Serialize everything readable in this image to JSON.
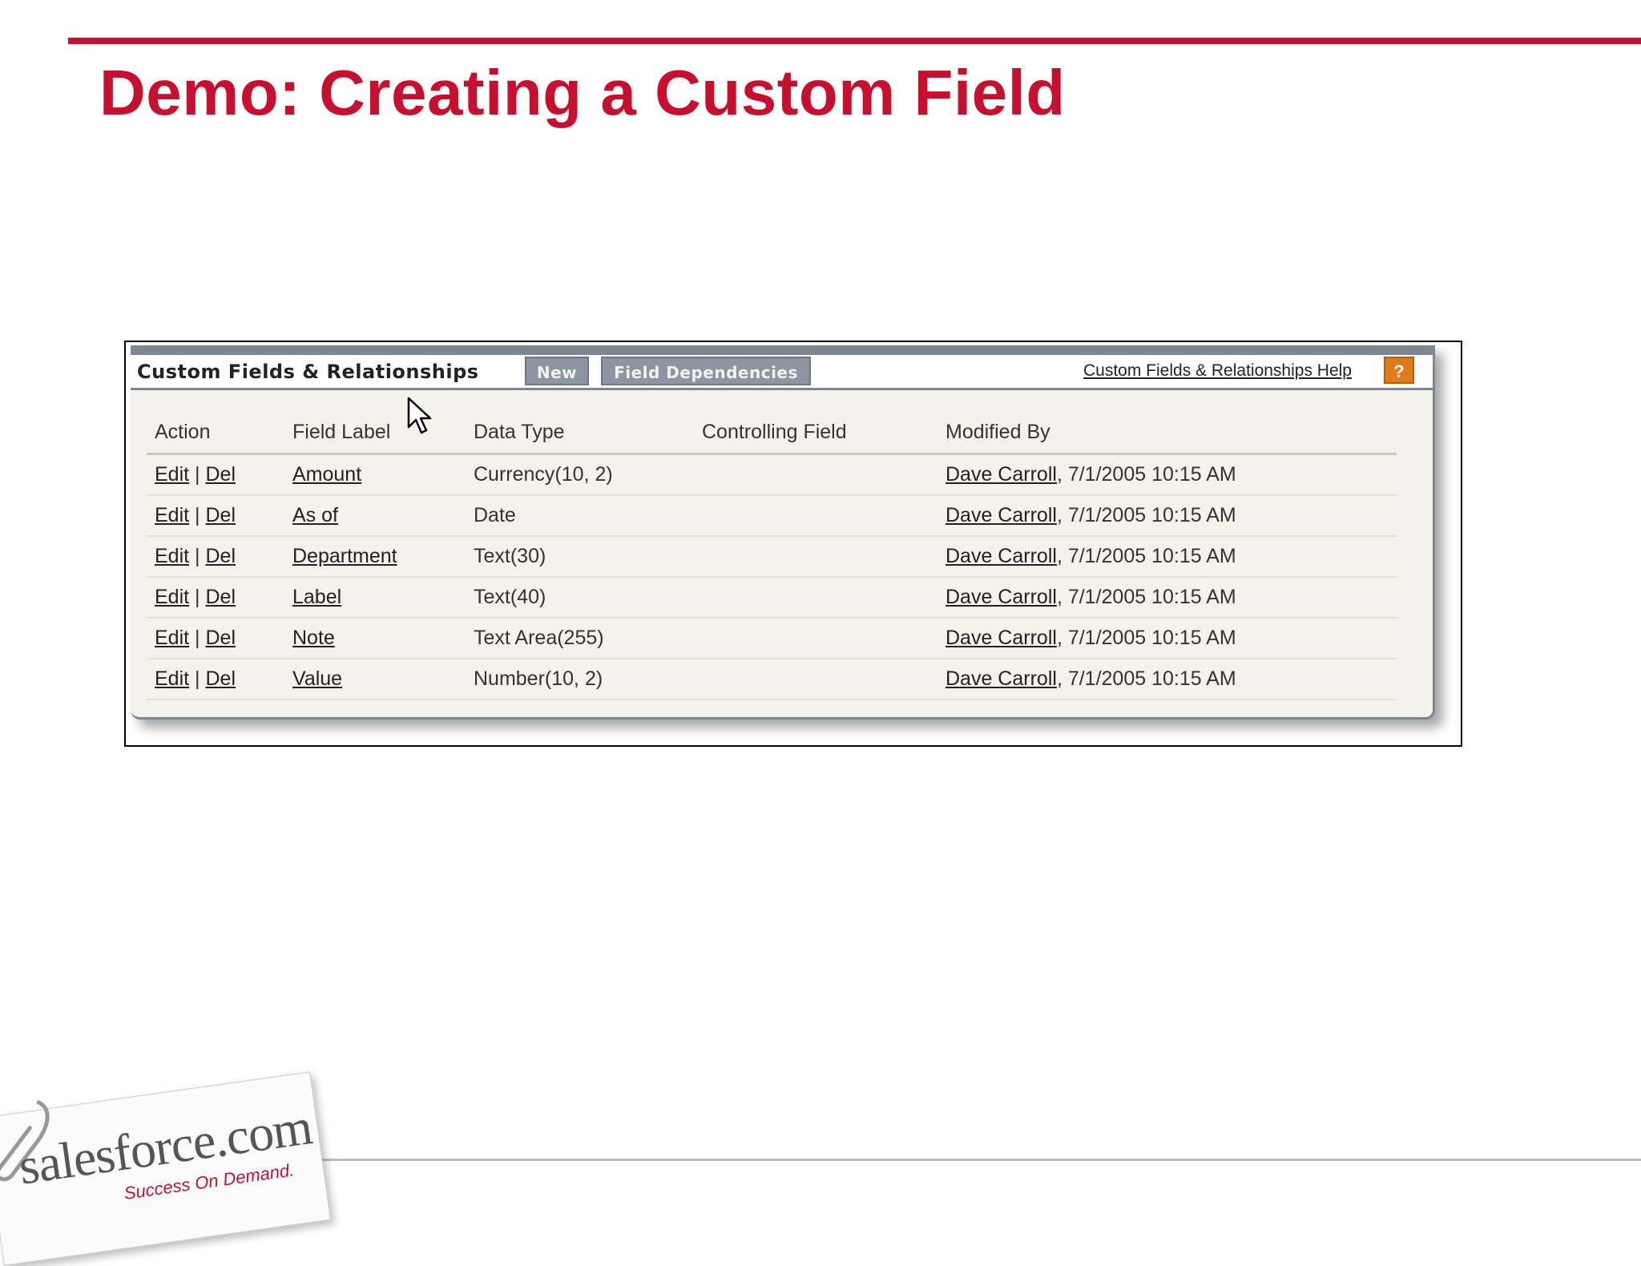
{
  "slide": {
    "title": "Demo: Creating a Custom Field"
  },
  "panel": {
    "title": "Custom Fields & Relationships",
    "new_label": "New",
    "dependencies_label": "Field Dependencies",
    "help_link": "Custom Fields & Relationships Help",
    "help_icon": "?"
  },
  "table": {
    "headers": [
      "Action",
      "Field Label",
      "Data Type",
      "Controlling Field",
      "Modified By"
    ],
    "edit_label": "Edit",
    "sep": "|",
    "del_label": "Del",
    "rows": [
      {
        "label": "Amount",
        "type": "Currency(10, 2)",
        "controlling": "",
        "modified_by": "Dave Carroll",
        "modified_at": ", 7/1/2005 10:15 AM"
      },
      {
        "label": "As of",
        "type": "Date",
        "controlling": "",
        "modified_by": "Dave Carroll",
        "modified_at": ", 7/1/2005 10:15 AM"
      },
      {
        "label": "Department",
        "type": "Text(30)",
        "controlling": "",
        "modified_by": "Dave Carroll",
        "modified_at": ", 7/1/2005 10:15 AM"
      },
      {
        "label": "Label",
        "type": "Text(40)",
        "controlling": "",
        "modified_by": "Dave Carroll",
        "modified_at": ", 7/1/2005 10:15 AM"
      },
      {
        "label": "Note",
        "type": "Text Area(255)",
        "controlling": "",
        "modified_by": "Dave Carroll",
        "modified_at": ", 7/1/2005 10:15 AM"
      },
      {
        "label": "Value",
        "type": "Number(10, 2)",
        "controlling": "",
        "modified_by": "Dave Carroll",
        "modified_at": ", 7/1/2005 10:15 AM"
      }
    ]
  },
  "logo": {
    "wordmark": "salesforce.com",
    "tagline": "Success On Demand."
  },
  "colors": {
    "accent": "#c8102e",
    "panel_border": "#7e8694",
    "help_orange": "#e07b1a"
  },
  "icons": {
    "cursor": "mouse-pointer-icon",
    "help": "help-icon",
    "clip": "paperclip-icon"
  }
}
